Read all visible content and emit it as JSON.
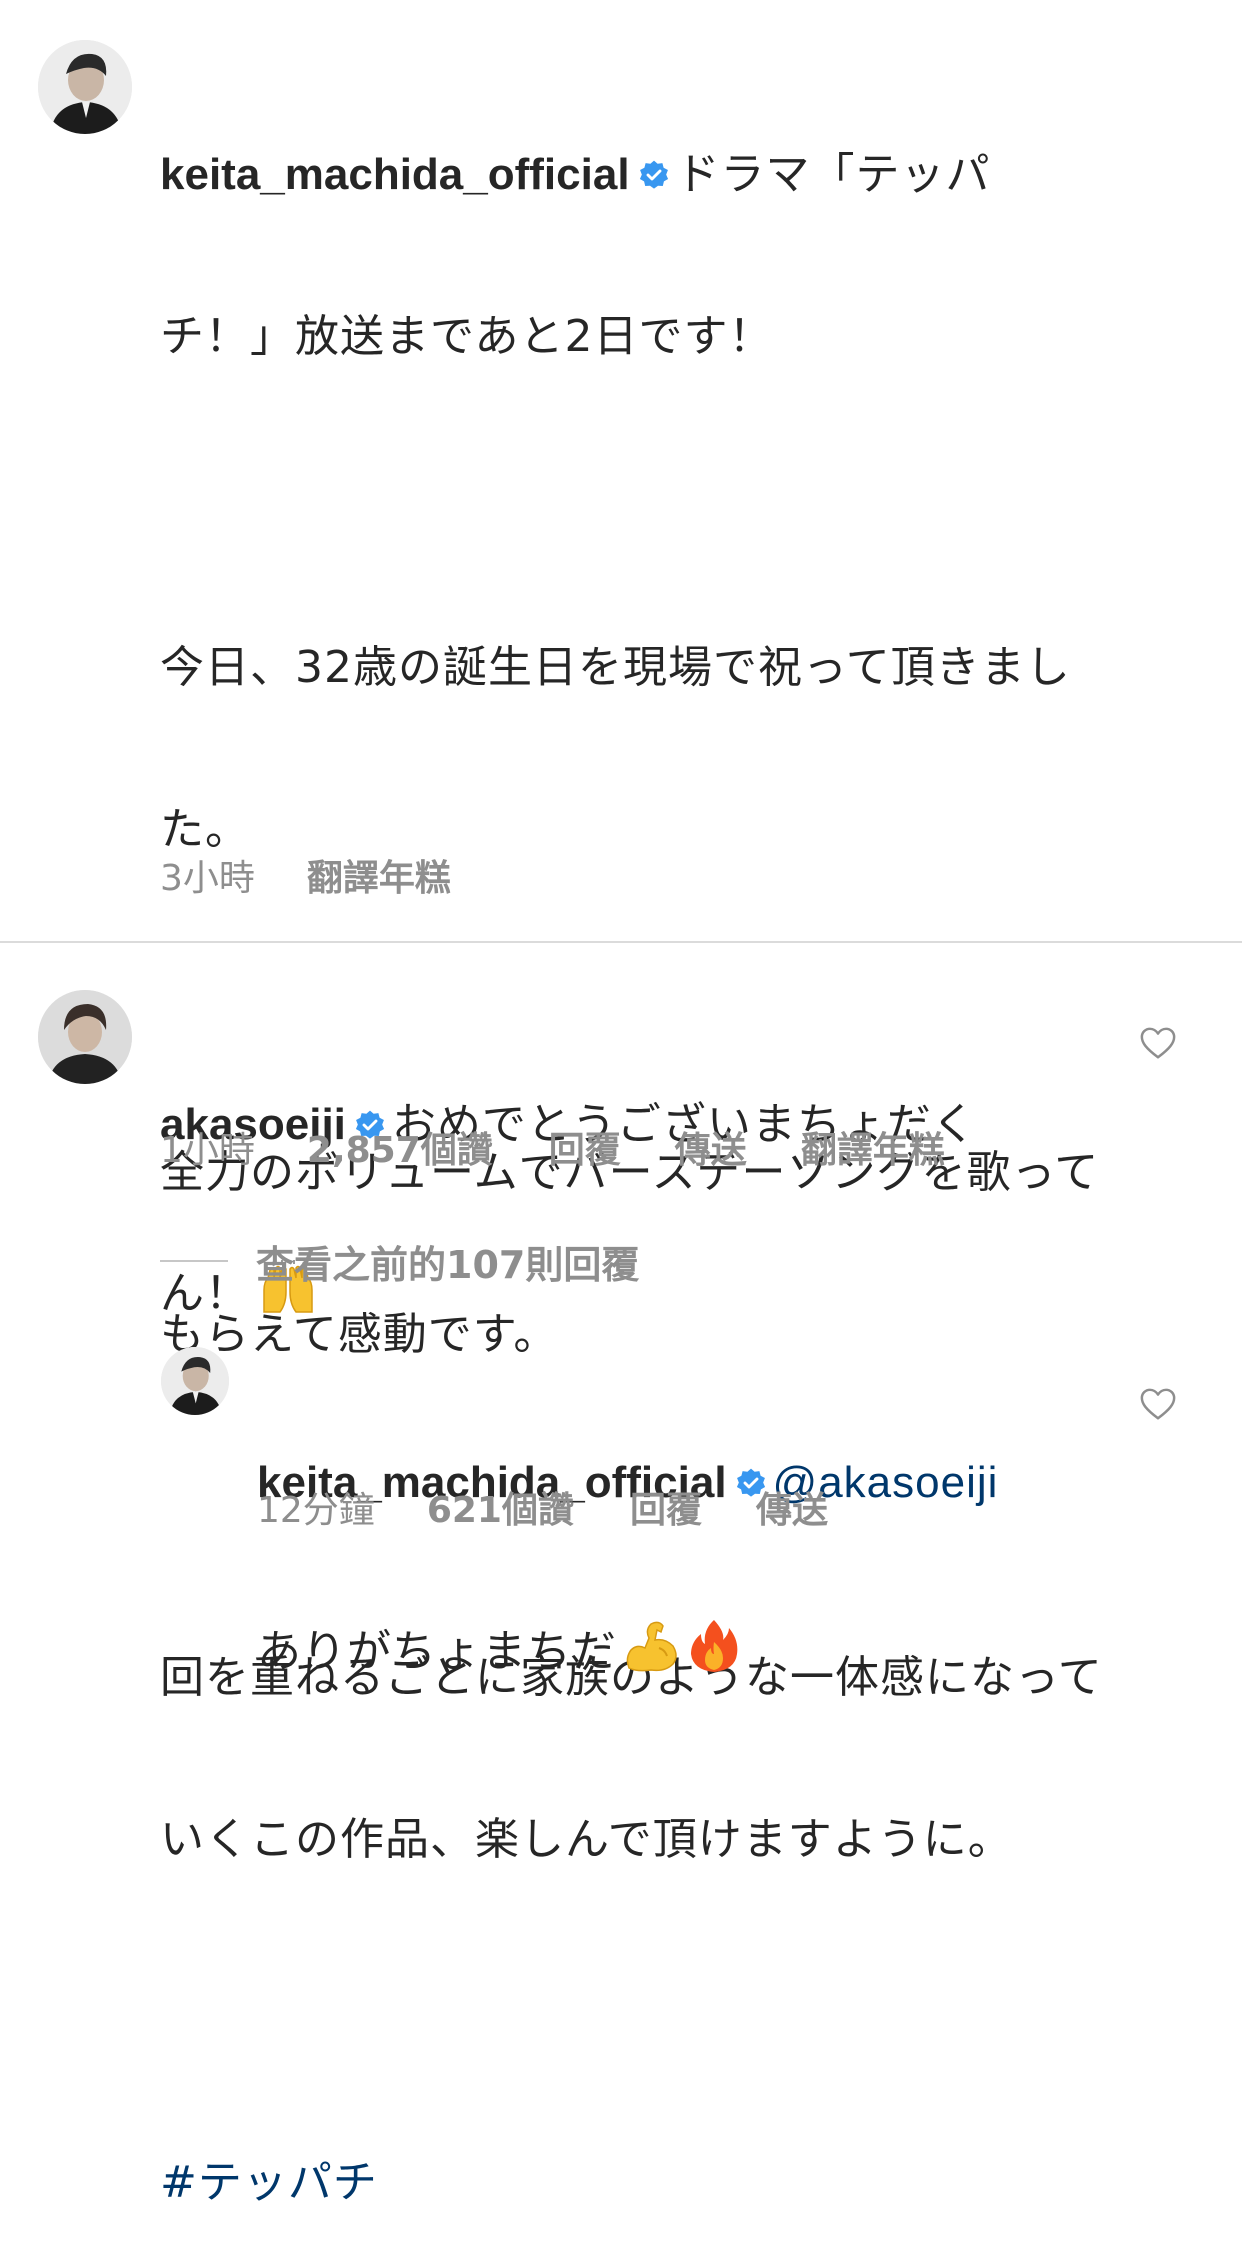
{
  "post": {
    "username": "keita_machida_official",
    "caption_lines": [
      "ドラマ「テッパ",
      "チ！」放送まであと2日です！",
      "",
      "今日、32歳の誕生日を現場で祝って頂きまし",
      "た。",
      "",
      "全力のボリュームでバースデーソングを歌って",
      "もらえて感動です。",
      "",
      "回を重ねるごとに家族のような一体感になって",
      "いくこの作品、楽しんで頂けますように。"
    ],
    "hashtag": "#テッパチ",
    "time": "3小時",
    "translate": "翻譯年糕"
  },
  "comment": {
    "username": "akasoeiji",
    "text_line1": "おめでとうございまちょだく",
    "text_line2": "ん！",
    "emoji": "raising-hands",
    "time": "1小時",
    "likes": "2,857個讚",
    "reply": "回覆",
    "send": "傳送",
    "translate": "翻譯年糕"
  },
  "view_replies": "查看之前的107則回覆",
  "reply": {
    "username": "keita_machida_official",
    "mention": "@akasoeiji",
    "text": "ありがちょまちだ",
    "emojis": [
      "flexed-biceps",
      "fire"
    ],
    "time": "12分鐘",
    "likes": "621個讚",
    "reply": "回覆",
    "send": "傳送"
  },
  "colors": {
    "text": "#262626",
    "muted": "#8e8e8e",
    "link": "#00376b",
    "verified": "#3897f0",
    "divider": "#dbdbdb"
  }
}
